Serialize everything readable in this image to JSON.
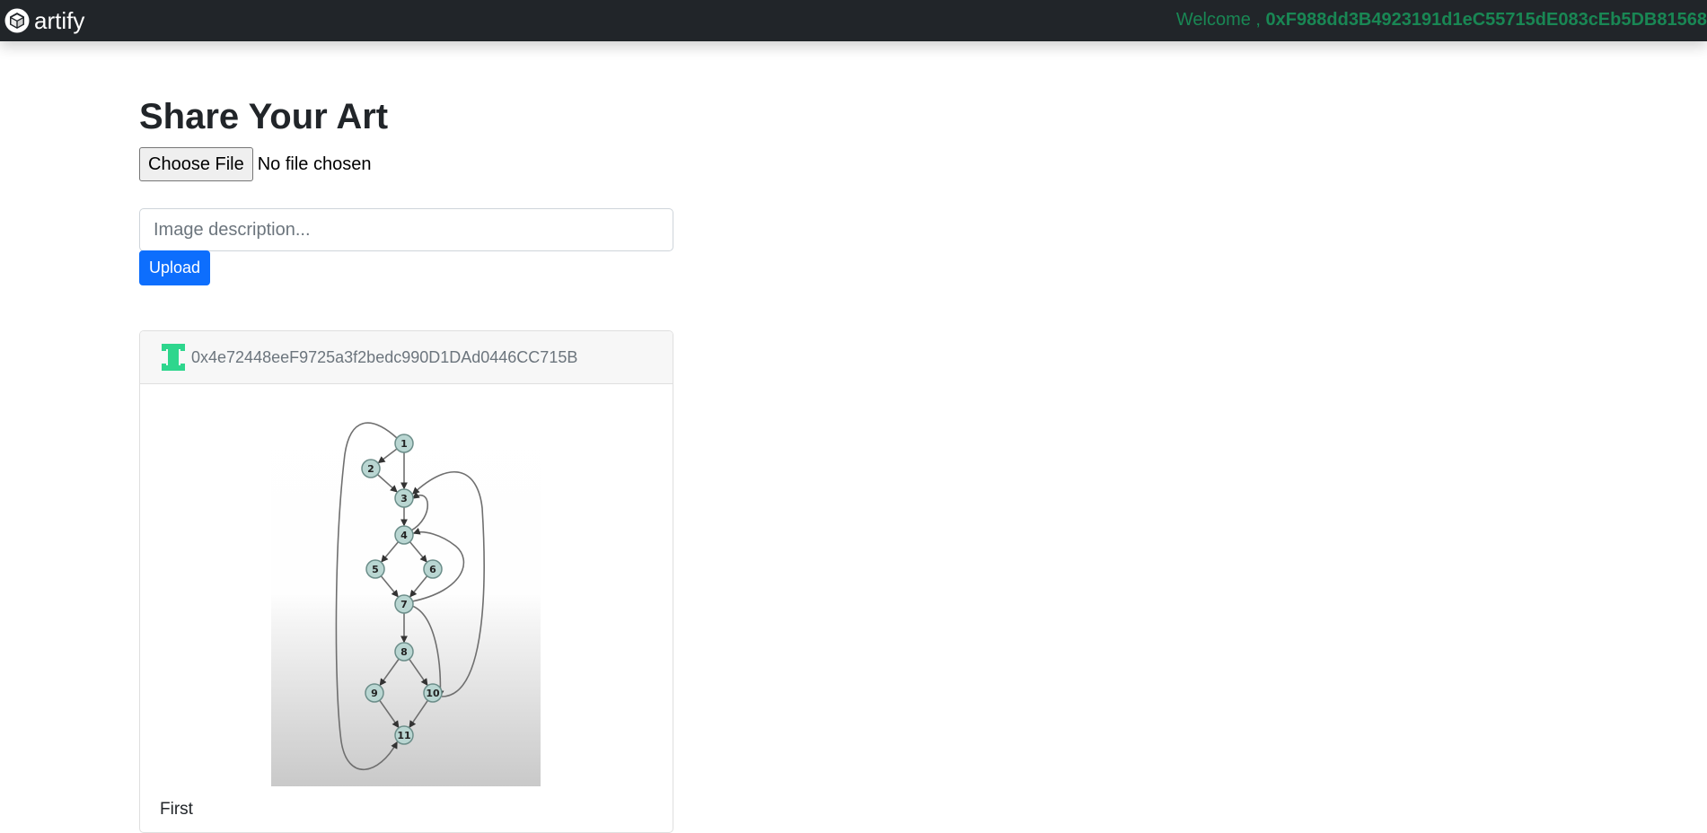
{
  "navbar": {
    "brand": "artify",
    "welcome_prefix": "Welcome ,",
    "welcome_address": "0xF988dd3B4923191d1eC55715dE083cEb5DB81568"
  },
  "upload_form": {
    "title": "Share Your Art",
    "choose_file_label": "Choose File",
    "file_status": "No file chosen",
    "description_placeholder": "Image description...",
    "upload_label": "Upload"
  },
  "posts": [
    {
      "owner_address": "0x4e72448eeF9725a3f2bedc990D1DAd0446CC715B",
      "description": "First",
      "image": {
        "nodes": [
          "1",
          "2",
          "3",
          "4",
          "5",
          "6",
          "7",
          "8",
          "9",
          "10",
          "11"
        ]
      }
    }
  ],
  "colors": {
    "navbar_bg": "#212529",
    "welcome_green": "#198754",
    "upload_blue": "#0d6efd",
    "identicon_green": "#2ed68d",
    "graph_node": "#b9d6d2"
  },
  "icons": {
    "brand": "cube-logo-icon",
    "owner": "identicon-avatar-icon"
  }
}
